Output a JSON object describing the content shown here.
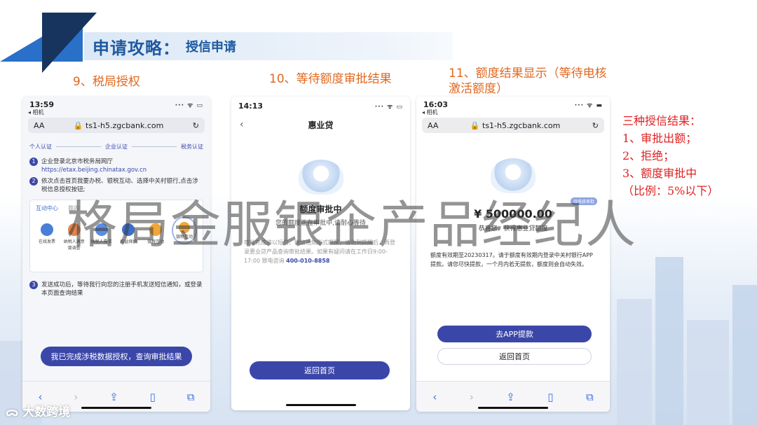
{
  "slide": {
    "title_main": "申请攻略：",
    "title_sub": "授信申请",
    "steps": [
      "9、税局授权",
      "10、等待额度审批结果",
      "11、额度结果显示（等待电核激活额度）"
    ],
    "step3_line1": "11、额度结果显示（等待电核",
    "step3_line2": "激活额度）",
    "watermark": "格局金服银企产品经纪人",
    "brand": "大数跨境"
  },
  "results": {
    "heading": "三种授信结果：",
    "items": [
      "1、审批出额；",
      "2、拒绝；",
      "3、额度审批中",
      "（比例：5%以下）"
    ]
  },
  "phone1": {
    "time": "13:59",
    "back_app": "◂ 相机",
    "text_size": "AA",
    "url": "ts1-h5.zgcbank.com",
    "progress": [
      "个人认证",
      "企业认证",
      "税务认证"
    ],
    "step1_title": "企业登录北京市税务局网厅",
    "step1_link": "https://etax.beijing.chinatax.gov.cn",
    "step2_title": "依次点击首页我要办税、银税互动、选择中关村银行,点击涉税信息授权按钮;",
    "tabs": [
      "互动中心",
      "我的"
    ],
    "icons": [
      "在线发票",
      "纳税人满意度调查",
      "纳税人需求",
      "权益保护",
      "银税互动",
      "银税互动"
    ],
    "step3_title": "发送成功后，等待我行向您的注册手机发送短信通知，或登录本页面查询结果",
    "button": "我已完成涉税数据授权，查询审批结果"
  },
  "phone2": {
    "time": "14:13",
    "nav_title": "惠业贷",
    "status_title": "额度审批中",
    "status_sub": "您的额度正在审批中,请耐心等待",
    "notice": "审批完成将以短信、微信通知形式提醒，请收到提醒后，再登录惠业贷产品查询审批结果。如果有疑问请在工作日9:00-17:00 致电咨询",
    "phone": "400-010-8858",
    "button": "返回首页"
  },
  "phone3": {
    "time": "16:03",
    "back_app": "◂ 相机",
    "text_size": "AA",
    "url": "ts1-h5.zgcbank.com",
    "badge": "待电核审批",
    "amount": "¥ 500000.00",
    "congrats": "恭喜您，获得惠业贷额度",
    "notice": "额度有效期至20230317。请于额度有效期内登录中关村银行APP提款。请您尽快提款，一个月内若无提款，额度则会自动失效。",
    "button_primary": "去APP提款",
    "button_secondary": "返回首页"
  },
  "colors": {
    "accent": "#3b47a8",
    "title": "#1f5aa0",
    "step": "#e0681f",
    "result": "#e02020"
  }
}
